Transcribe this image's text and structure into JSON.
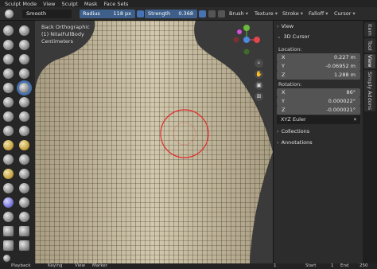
{
  "menubar": {
    "mode": "Sculpt Mode",
    "items": [
      "View",
      "Sculpt",
      "Mask",
      "Face Sets"
    ]
  },
  "header": {
    "brush_name": "Smooth",
    "radius_label": "Radius",
    "radius_value": "118 px",
    "strength_label": "Strength",
    "strength_value": "0.368",
    "menus": [
      "Brush",
      "Texture",
      "Stroke",
      "Falloff",
      "Cursor"
    ]
  },
  "viewport": {
    "view_name": "Back Orthographic",
    "object_name": "(1) NitaiFullBody",
    "units": "Centimeters"
  },
  "sidebar": {
    "view_label": "View",
    "cursor_label": "3D Cursor",
    "location_label": "Location:",
    "location": [
      {
        "axis": "X",
        "value": "0.227 m"
      },
      {
        "axis": "Y",
        "value": "-0.06952 m"
      },
      {
        "axis": "Z",
        "value": "1.288 m"
      }
    ],
    "rotation_label": "Rotation:",
    "rotation": [
      {
        "axis": "X",
        "value": "86°"
      },
      {
        "axis": "Y",
        "value": "0.000022°"
      },
      {
        "axis": "Z",
        "value": "-0.000021°"
      }
    ],
    "rotation_mode": "XYZ Euler",
    "collections_label": "Collections",
    "annotations_label": "Annotations"
  },
  "tabs": [
    "Item",
    "Tool",
    "View",
    "Simply Addons"
  ],
  "timeline": {
    "playback": "Playback",
    "keying": "Keying",
    "view": "View",
    "marker": "Marker",
    "frame": "1",
    "start_label": "Start",
    "start_value": "1",
    "end_label": "End",
    "end_value": "250"
  },
  "colors": {
    "accent": "#4772b3",
    "mesh": "#c9bfa3",
    "wire": "#2a2418",
    "brush_circle": "#e02a2a"
  }
}
